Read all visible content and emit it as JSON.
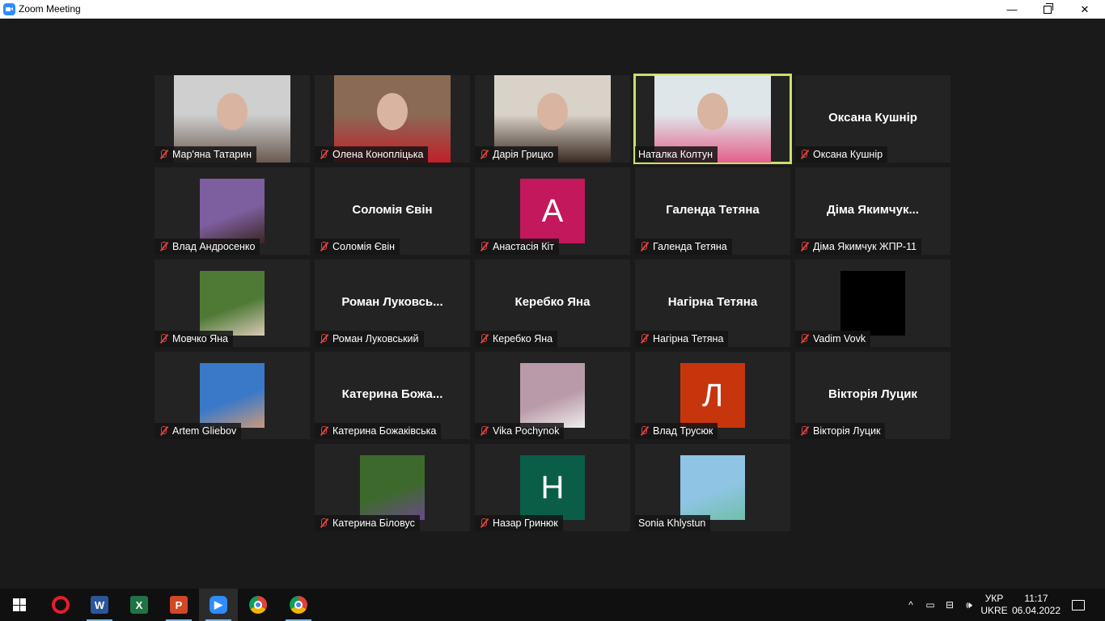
{
  "window": {
    "title": "Zoom Meeting",
    "minimize": "—",
    "close": "✕"
  },
  "participants": [
    {
      "name": "Мар'яна Татарин",
      "type": "video",
      "muted": true,
      "bg": "#cfcfcf",
      "fg": "#6a5a50"
    },
    {
      "name": "Олена Конопліцька",
      "type": "video",
      "muted": true,
      "bg": "#8a6a55",
      "fg": "#c21f2a"
    },
    {
      "name": "Дарія Грицко",
      "type": "video",
      "muted": true,
      "bg": "#d9d2c8",
      "fg": "#3a2a22"
    },
    {
      "name": "Наталка Колтун",
      "type": "video",
      "muted": false,
      "active": true,
      "bg": "#dfe6ea",
      "fg": "#e4608a"
    },
    {
      "name": "Оксана Кушнір",
      "type": "name",
      "muted": true,
      "display": "Оксана Кушнір"
    },
    {
      "name": "Влад Андросенко",
      "type": "photo",
      "muted": true,
      "bg": "#7d5e9e",
      "fg": "#3a2520"
    },
    {
      "name": "Соломія Євін",
      "type": "name",
      "muted": true,
      "display": "Соломія Євін"
    },
    {
      "name": "Анастасія Кіт",
      "type": "letter",
      "muted": true,
      "letter": "A",
      "color": "#c4185c"
    },
    {
      "name": "Галенда Тетяна",
      "type": "name",
      "muted": true,
      "display": "Галенда Тетяна"
    },
    {
      "name": "Діма Якимчук ЖПР-11",
      "type": "name",
      "muted": true,
      "display": "Діма Якимчук..."
    },
    {
      "name": "Мовчко Яна",
      "type": "photo",
      "muted": true,
      "bg": "#4f7a36",
      "fg": "#d8c9b8"
    },
    {
      "name": "Роман Луковський",
      "type": "name",
      "muted": true,
      "display": "Роман Луковсь..."
    },
    {
      "name": "Керебко Яна",
      "type": "name",
      "muted": true,
      "display": "Керебко Яна"
    },
    {
      "name": "Нагірна Тетяна",
      "type": "name",
      "muted": true,
      "display": "Нагірна Тетяна"
    },
    {
      "name": "Vadim Vovk",
      "type": "photo",
      "muted": true,
      "bg": "#000000",
      "fg": "#000000"
    },
    {
      "name": "Artem Gliebov",
      "type": "photo",
      "muted": true,
      "bg": "#3a78c8",
      "fg": "#c99a7a"
    },
    {
      "name": "Катерина Божаківська",
      "type": "name",
      "muted": true,
      "display": "Катерина Божа..."
    },
    {
      "name": "Vika Pochynok",
      "type": "photo",
      "muted": true,
      "bg": "#b99aa8",
      "fg": "#eeeeee"
    },
    {
      "name": "Влад Трусюк",
      "type": "letter",
      "muted": true,
      "letter": "Л",
      "color": "#c7350c"
    },
    {
      "name": "Вікторія Луцик",
      "type": "name",
      "muted": true,
      "display": "Вікторія Луцик"
    },
    {
      "name": "Катерина Біловус",
      "type": "photo",
      "muted": true,
      "bg": "#3d6a2c",
      "fg": "#6a4a8a"
    },
    {
      "name": "Назар Гринюк",
      "type": "letter",
      "muted": true,
      "letter": "Н",
      "color": "#0a5e48"
    },
    {
      "name": "Sonia Khlystun",
      "type": "photo",
      "muted": false,
      "bg": "#8fc4e4",
      "fg": "#6fc0a8"
    }
  ],
  "taskbar": {
    "apps": [
      {
        "name": "opera",
        "running": false
      },
      {
        "name": "word",
        "letter": "W",
        "running": true
      },
      {
        "name": "excel",
        "letter": "X",
        "running": false
      },
      {
        "name": "powerpoint",
        "letter": "P",
        "running": true
      },
      {
        "name": "zoom",
        "running": true,
        "active": true
      },
      {
        "name": "chrome",
        "running": false
      },
      {
        "name": "chrome-profile",
        "running": true
      }
    ],
    "tray": {
      "chevron": "^",
      "lang_top": "УКР",
      "lang_bottom": "UKRE",
      "time": "11:17",
      "date": "06.04.2022"
    }
  }
}
